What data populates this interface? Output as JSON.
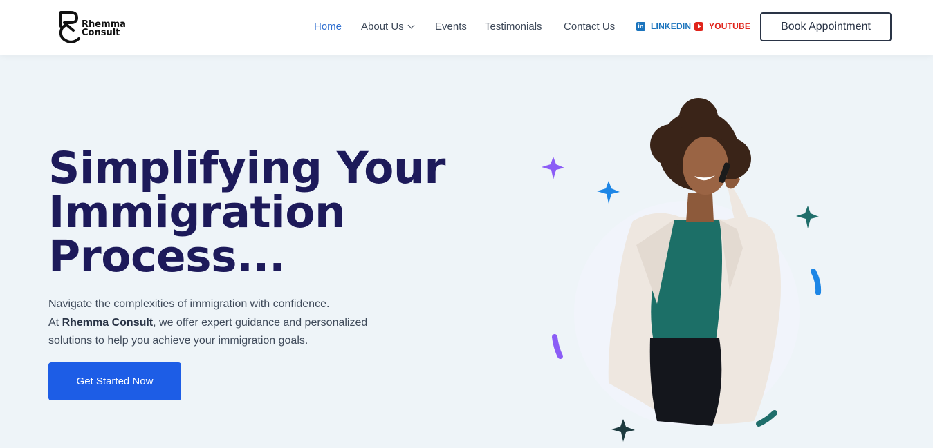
{
  "logo": {
    "line1": "Rhemma",
    "line2": "Consult"
  },
  "nav": {
    "home": "Home",
    "about": "About Us",
    "events": "Events",
    "testimonials": "Testimonials",
    "contact": "Contact Us"
  },
  "social": {
    "linkedin": "LINKEDIN",
    "youtube": "YOUTUBE"
  },
  "header": {
    "book_label": "Book Appointment"
  },
  "hero": {
    "title_line1": "Simplifying Your",
    "title_line2": "Immigration",
    "title_line3": "Process...",
    "desc_line1": "Navigate the complexities of immigration with confidence.",
    "desc_line2_prefix": "At ",
    "desc_line2_brand": "Rhemma Consult",
    "desc_line2_suffix": ", we offer expert guidance and personalized",
    "desc_line3": "solutions to help you achieve your immigration goals.",
    "cta_label": "Get Started Now"
  },
  "colors": {
    "accent": "#1d5de6",
    "title": "#1d1a5a",
    "nav_active": "#2f6fd0"
  }
}
